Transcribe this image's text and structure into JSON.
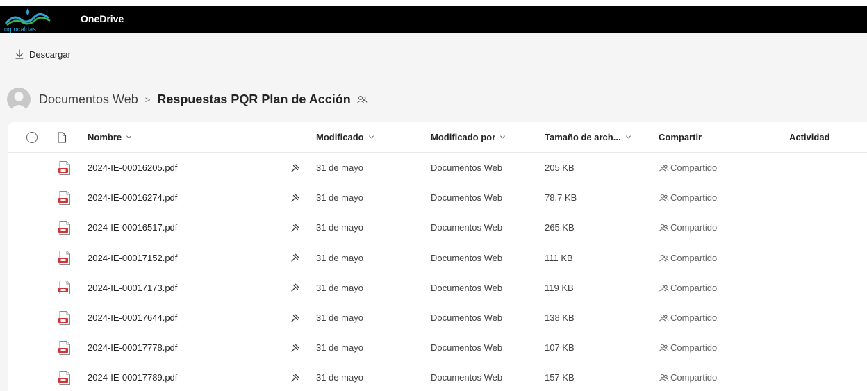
{
  "app": {
    "brand_text": "orpocaldas",
    "title": "OneDrive",
    "colors": {
      "appbar": "#000000",
      "accent": "#0f6cbd",
      "pdf": "#d13438"
    }
  },
  "command_bar": {
    "download_label": "Descargar",
    "download_icon": "download-icon"
  },
  "breadcrumb": {
    "root": "Documentos Web",
    "separator": ">",
    "current": "Respuestas PQR Plan de Acción",
    "shared_icon": "people-icon"
  },
  "columns": {
    "name": "Nombre",
    "modified": "Modificado",
    "modified_by": "Modificado por",
    "size": "Tamaño de arch...",
    "sharing": "Compartir",
    "activity": "Actividad"
  },
  "files": [
    {
      "name": "2024-IE-00016205.pdf",
      "modified": "31 de mayo",
      "modified_by": "Documentos Web",
      "size": "205 KB",
      "sharing": "Compartido"
    },
    {
      "name": "2024-IE-00016274.pdf",
      "modified": "31 de mayo",
      "modified_by": "Documentos Web",
      "size": "78.7 KB",
      "sharing": "Compartido"
    },
    {
      "name": "2024-IE-00016517.pdf",
      "modified": "31 de mayo",
      "modified_by": "Documentos Web",
      "size": "265 KB",
      "sharing": "Compartido"
    },
    {
      "name": "2024-IE-00017152.pdf",
      "modified": "31 de mayo",
      "modified_by": "Documentos Web",
      "size": "111 KB",
      "sharing": "Compartido"
    },
    {
      "name": "2024-IE-00017173.pdf",
      "modified": "31 de mayo",
      "modified_by": "Documentos Web",
      "size": "119 KB",
      "sharing": "Compartido"
    },
    {
      "name": "2024-IE-00017644.pdf",
      "modified": "31 de mayo",
      "modified_by": "Documentos Web",
      "size": "138 KB",
      "sharing": "Compartido"
    },
    {
      "name": "2024-IE-00017778.pdf",
      "modified": "31 de mayo",
      "modified_by": "Documentos Web",
      "size": "107 KB",
      "sharing": "Compartido"
    },
    {
      "name": "2024-IE-00017789.pdf",
      "modified": "31 de mayo",
      "modified_by": "Documentos Web",
      "size": "157 KB",
      "sharing": "Compartido"
    }
  ]
}
